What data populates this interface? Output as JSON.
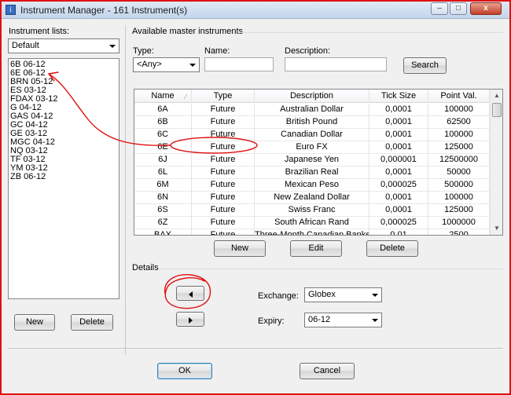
{
  "window": {
    "title": "Instrument Manager - 161 Instrument(s)",
    "title_icon": "i",
    "controls": {
      "minimize": "–",
      "maximize": "□",
      "close": "x"
    }
  },
  "left": {
    "instrument_lists_label": "Instrument lists:",
    "selected_list": "Default",
    "items": [
      "6B 06-12",
      "6E 06-12",
      "BRN 05-12",
      "ES 03-12",
      "FDAX 03-12",
      "G 04-12",
      "GAS 04-12",
      "GC 04-12",
      "GE 03-12",
      "MGC 04-12",
      "NQ 03-12",
      "TF 03-12",
      "YM 03-12",
      "ZB 06-12"
    ],
    "new_label": "New",
    "delete_label": "Delete"
  },
  "master": {
    "section_label": "Available master instruments",
    "type_label": "Type:",
    "type_value": "<Any>",
    "name_label": "Name:",
    "name_value": "",
    "description_label": "Description:",
    "description_value": "",
    "search_label": "Search",
    "columns": [
      "Name",
      "Type",
      "Description",
      "Tick Size",
      "Point Val."
    ],
    "rows": [
      [
        "6A",
        "Future",
        "Australian Dollar",
        "0,0001",
        "100000"
      ],
      [
        "6B",
        "Future",
        "British Pound",
        "0,0001",
        "62500"
      ],
      [
        "6C",
        "Future",
        "Canadian Dollar",
        "0,0001",
        "100000"
      ],
      [
        "6E",
        "Future",
        "Euro FX",
        "0,0001",
        "125000"
      ],
      [
        "6J",
        "Future",
        "Japanese Yen",
        "0,000001",
        "12500000"
      ],
      [
        "6L",
        "Future",
        "Brazilian Real",
        "0,0001",
        "50000"
      ],
      [
        "6M",
        "Future",
        "Mexican Peso",
        "0,000025",
        "500000"
      ],
      [
        "6N",
        "Future",
        "New Zealand Dollar",
        "0,0001",
        "100000"
      ],
      [
        "6S",
        "Future",
        "Swiss Franc",
        "0,0001",
        "125000"
      ],
      [
        "6Z",
        "Future",
        "South African Rand",
        "0,000025",
        "1000000"
      ],
      [
        "BAX",
        "Future",
        "Three-Month Canadian Bankers'",
        "0,01",
        "2500"
      ]
    ],
    "new_label": "New",
    "edit_label": "Edit",
    "delete_label": "Delete"
  },
  "details": {
    "section_label": "Details",
    "prev_icon": "triangle-left-icon",
    "next_icon": "triangle-right-icon",
    "exchange_label": "Exchange:",
    "exchange_value": "Globex",
    "expiry_label": "Expiry:",
    "expiry_value": "06-12"
  },
  "footer": {
    "ok_label": "OK",
    "cancel_label": "Cancel"
  },
  "colors": {
    "annotation": "#e01010",
    "title_bar": "#c4d5eb",
    "dialog_bg": "#f0f0f0"
  }
}
